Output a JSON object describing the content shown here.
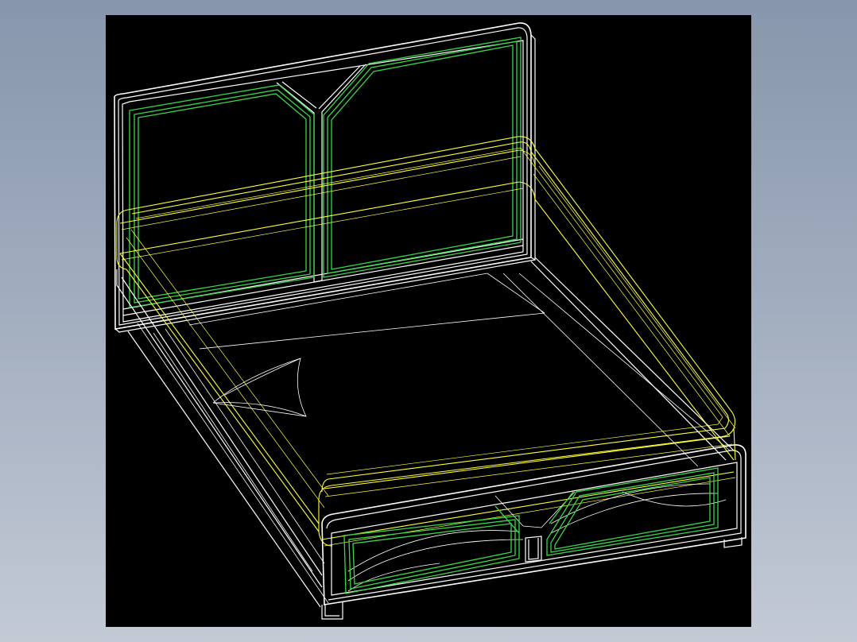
{
  "window": {
    "background_gradient_top": "#8796ac",
    "background_gradient_bottom": "#c3cad5"
  },
  "viewport": {
    "background": "#000000",
    "content": "3d-wireframe-bed-drawing"
  },
  "colors": {
    "outline": "#ffffff",
    "panel_frame": "#39d64a",
    "mattress": "#ffff3c"
  }
}
